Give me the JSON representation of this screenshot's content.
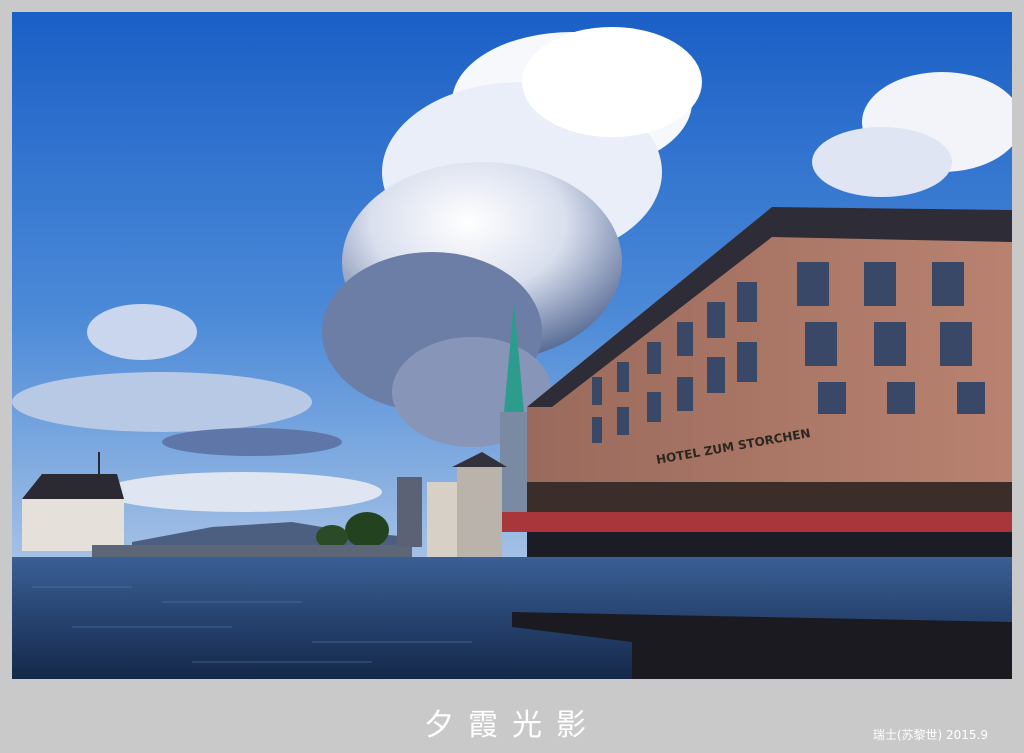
{
  "caption": {
    "title": "夕霞光影",
    "credit": "瑞士(苏黎世) 2015.9"
  },
  "scene": {
    "subject": "zurich-limmat-river-evening",
    "building_sign": "HOTEL ZUM STORCHEN",
    "colors": {
      "sky_top": "#1b63c9",
      "sky_bottom": "#8fb6e6",
      "cloud": "#f4f6fb",
      "cloud_shadow": "#5c6f95",
      "hotel_wall": "#b07866",
      "roof": "#2e2c36",
      "water": "#1f3a66",
      "spire": "#2e9c8c",
      "frame": "#c9c9c9"
    }
  }
}
